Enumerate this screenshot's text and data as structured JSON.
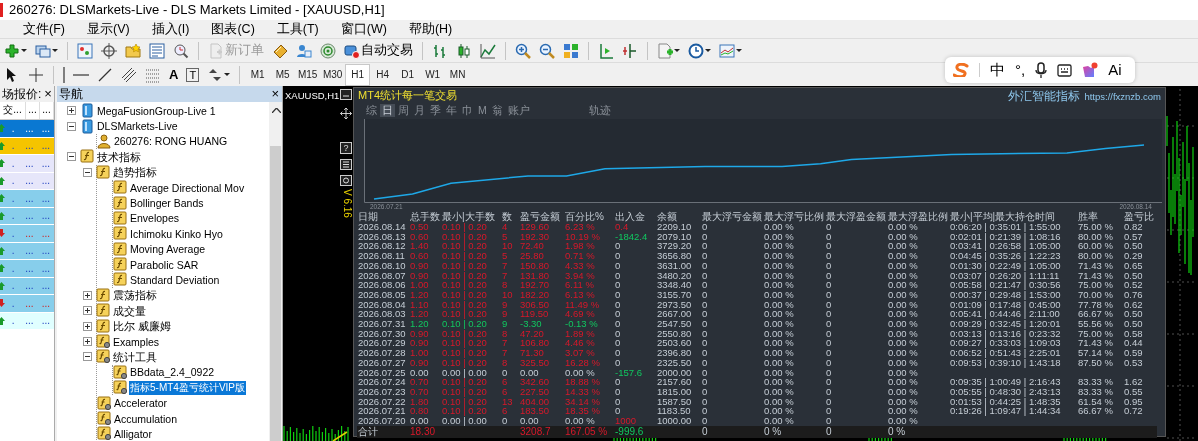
{
  "window": {
    "title": "260276: DLSMarkets-Live - DLS Markets Limited - [XAUUSD,H1]"
  },
  "menu": [
    "文件(F)",
    "显示(V)",
    "插入(I)",
    "图表(C)",
    "工具(T)",
    "窗口(W)",
    "帮助(H)"
  ],
  "toolbar": {
    "buttons": [
      {
        "label": "新订单",
        "disabled": true
      },
      {
        "label": "自动交易",
        "disabled": false
      }
    ]
  },
  "drawing_tools": [
    "A",
    "T"
  ],
  "timeframes": [
    {
      "label": "M1",
      "selected": false
    },
    {
      "label": "M5",
      "selected": false
    },
    {
      "label": "M15",
      "selected": false
    },
    {
      "label": "M30",
      "selected": false
    },
    {
      "label": "H1",
      "selected": true
    },
    {
      "label": "H4",
      "selected": false
    },
    {
      "label": "D1",
      "selected": false
    },
    {
      "label": "W1",
      "selected": false
    },
    {
      "label": "MN",
      "selected": false
    }
  ],
  "ime_bar": {
    "mode": "中",
    "punctuation": "°,",
    "ai": "Ai"
  },
  "market_watch": {
    "title": "场报价:",
    "close": "×",
    "columns": [
      "交...",
      "...",
      "..."
    ],
    "rows": [
      {
        "color": "#0a78d2",
        "rising": true,
        "selected": true,
        "cells": [
          ".",
          "...",
          "..."
        ]
      },
      {
        "color": "#f5c400",
        "rising": true,
        "selected": false,
        "cells": [
          ".",
          "...",
          "..."
        ]
      },
      {
        "color": "#e6e6fa",
        "rising": true,
        "selected": false,
        "cells": [
          ".",
          "...",
          "..."
        ]
      },
      {
        "color": "#e6e6fa",
        "rising": true,
        "selected": false,
        "cells": [
          ".",
          "...",
          "..."
        ]
      },
      {
        "color": "#87ceeb",
        "rising": true,
        "selected": false,
        "cells": [
          ".",
          "...",
          "..."
        ]
      },
      {
        "color": "#87ceeb",
        "rising": true,
        "selected": false,
        "cells": [
          ".",
          "...",
          "..."
        ]
      },
      {
        "color": "#87ceeb",
        "rising": false,
        "selected": false,
        "cells": [
          ".",
          "...",
          "..."
        ]
      },
      {
        "color": "#87ceeb",
        "rising": true,
        "selected": false,
        "cells": [
          ".",
          "...",
          "..."
        ]
      },
      {
        "color": "#87ceeb",
        "rising": true,
        "selected": false,
        "cells": [
          ".",
          "...",
          "..."
        ]
      },
      {
        "color": "#87ceeb",
        "rising": true,
        "selected": false,
        "cells": [
          ".",
          "...",
          "..."
        ]
      },
      {
        "color": "#87ceeb",
        "rising": false,
        "selected": false,
        "cells": [
          ".",
          "...",
          "..."
        ]
      },
      {
        "color": "#e0ffff",
        "rising": true,
        "selected": false,
        "cells": [
          ".",
          "...",
          "..."
        ]
      }
    ]
  },
  "navigator": {
    "title": "导航",
    "close": "×",
    "tree": [
      {
        "label": "MegaFusionGroup-Live 1",
        "kind": "server",
        "expanded": false,
        "selected": false
      },
      {
        "label": "DLSMarkets-Live",
        "kind": "server",
        "expanded": true,
        "selected": false,
        "children": [
          {
            "label": "260276: RONG HUANG",
            "kind": "account",
            "selected": false
          }
        ]
      },
      {
        "label": "技术指标",
        "kind": "indicator",
        "expanded": true,
        "selected": false,
        "children": [
          {
            "label": "趋势指标",
            "kind": "indicator",
            "expanded": true,
            "selected": false,
            "children": [
              {
                "label": "Average Directional Mov",
                "kind": "indicator",
                "selected": false
              },
              {
                "label": "Bollinger Bands",
                "kind": "indicator",
                "selected": false
              },
              {
                "label": "Envelopes",
                "kind": "indicator",
                "selected": false
              },
              {
                "label": "Ichimoku Kinko Hyo",
                "kind": "indicator",
                "selected": false
              },
              {
                "label": "Moving Average",
                "kind": "indicator",
                "selected": false
              },
              {
                "label": "Parabolic SAR",
                "kind": "indicator",
                "selected": false
              },
              {
                "label": "Standard Deviation",
                "kind": "indicator",
                "selected": false
              }
            ]
          },
          {
            "label": "震荡指标",
            "kind": "indicator",
            "expanded": false,
            "selected": false
          },
          {
            "label": "成交量",
            "kind": "indicator",
            "expanded": false,
            "selected": false
          },
          {
            "label": "比尔 威廉姆",
            "kind": "indicator",
            "expanded": false,
            "selected": false
          },
          {
            "label": "Examples",
            "kind": "custom",
            "expanded": false,
            "selected": false
          },
          {
            "label": "统计工具",
            "kind": "custom",
            "expanded": true,
            "selected": false,
            "children": [
              {
                "label": "BBdata_2.4_0922",
                "kind": "custom",
                "selected": false
              },
              {
                "label": "指标5-MT4盈亏统计VIP版",
                "kind": "custom",
                "selected": true
              }
            ]
          },
          {
            "label": "Accelerator",
            "kind": "custom",
            "selected": false
          },
          {
            "label": "Accumulation",
            "kind": "custom",
            "selected": false
          },
          {
            "label": "Alligator",
            "kind": "custom",
            "selected": false
          }
        ]
      }
    ]
  },
  "chart": {
    "symbol": "XAUUSD,H1",
    "help": "?",
    "version": "V 6.16"
  },
  "stats_panel": {
    "title": "MT4统计每一笔交易",
    "brand": "外汇智能指标",
    "url": "https://fxznzb.com",
    "tabs": [
      {
        "label": "综",
        "selected": false
      },
      {
        "label": "日",
        "selected": true
      },
      {
        "label": "周",
        "selected": false
      },
      {
        "label": "月",
        "selected": false
      },
      {
        "label": "季",
        "selected": false
      },
      {
        "label": "年",
        "selected": false
      },
      {
        "label": "巾",
        "selected": false
      },
      {
        "label": "M",
        "selected": false
      },
      {
        "label": "翁",
        "selected": false
      },
      {
        "label": "账户",
        "selected": false
      }
    ],
    "trace_tab": {
      "label": "轨迹",
      "selected": false
    },
    "equity_chart": {
      "start_label": "2026.07.21",
      "end_label": "2026.08.14"
    },
    "columns": [
      "日期",
      "总手数",
      "最小|大手数",
      "数",
      "盈亏金额",
      "百分比%",
      "出入金",
      "余额",
      "最大浮亏金额",
      "最大浮亏比例",
      "最大浮盈金额",
      "最大浮盈比例",
      "最小|平均|最大持仓时间",
      "胜率",
      "盈亏比"
    ],
    "rows": [
      {
        "gain": true,
        "loss": false,
        "deposit": true,
        "withdrawal": false,
        "cells": [
          "2026.08.14",
          "0.50",
          "0.10 | 0.20",
          "4",
          "129.60",
          "6.23 %",
          "0.4",
          "2209.10",
          "0",
          "0.00 %",
          "0",
          "0.00 %",
          "0:06:20 | 0:35:01 | 1:55:00",
          "75.00 %",
          "0.82"
        ]
      },
      {
        "gain": true,
        "loss": false,
        "deposit": false,
        "withdrawal": true,
        "cells": [
          "2026.08.13",
          "0.60",
          "0.10 | 0.20",
          "5",
          "192.30",
          "10.19 %",
          "-1842.4",
          "2079.10",
          "0",
          "0.00 %",
          "0",
          "0.00 %",
          "0:02:01 | 0:21:39 | 1:08:16",
          "80.00 %",
          "0.57"
        ]
      },
      {
        "gain": true,
        "loss": false,
        "deposit": false,
        "withdrawal": false,
        "cells": [
          "2026.08.12",
          "1.40",
          "0.10 | 0.20",
          "10",
          "72.40",
          "1.98 %",
          "0",
          "3729.20",
          "0",
          "0.00 %",
          "0",
          "0.00 %",
          "0:03:41 | 0:26:58 | 1:05:00",
          "60.00 %",
          "0.50"
        ]
      },
      {
        "gain": true,
        "loss": false,
        "deposit": false,
        "withdrawal": false,
        "cells": [
          "2026.08.11",
          "0.60",
          "0.10 | 0.20",
          "5",
          "25.80",
          "0.71 %",
          "0",
          "3656.80",
          "0",
          "0.00 %",
          "0",
          "0.00 %",
          "0:04:45 | 0:35:26 | 1:22:23",
          "80.00 %",
          "0.29"
        ]
      },
      {
        "gain": true,
        "loss": false,
        "deposit": false,
        "withdrawal": false,
        "cells": [
          "2026.08.10",
          "0.90",
          "0.10 | 0.20",
          "7",
          "150.80",
          "4.33 %",
          "0",
          "3631.00",
          "0",
          "0.00 %",
          "0",
          "0.00 %",
          "0:01:30 | 0:22:49 | 1:05:00",
          "71.43 %",
          "0.65"
        ]
      },
      {
        "gain": true,
        "loss": false,
        "deposit": false,
        "withdrawal": false,
        "cells": [
          "2026.08.07",
          "0.90",
          "0.10 | 0.20",
          "7",
          "131.80",
          "3.94 %",
          "0",
          "3480.20",
          "0",
          "0.00 %",
          "0",
          "0.00 %",
          "0:03:07 | 0:26:20 | 1:11:11",
          "71.43 %",
          "0.50"
        ]
      },
      {
        "gain": true,
        "loss": false,
        "deposit": false,
        "withdrawal": false,
        "cells": [
          "2026.08.06",
          "1.00",
          "0.10 | 0.20",
          "8",
          "192.70",
          "6.11 %",
          "0",
          "3348.40",
          "0",
          "0.00 %",
          "0",
          "0.00 %",
          "0:05:58 | 0:21:47 | 0:30:56",
          "75.00 %",
          "0.52"
        ]
      },
      {
        "gain": true,
        "loss": false,
        "deposit": false,
        "withdrawal": false,
        "cells": [
          "2026.08.05",
          "1.20",
          "0.10 | 0.20",
          "10",
          "182.20",
          "6.13 %",
          "0",
          "3155.70",
          "0",
          "0.00 %",
          "0",
          "0.00 %",
          "0:00:37 | 0:29:48 | 1:53:00",
          "70.00 %",
          "0.76"
        ]
      },
      {
        "gain": true,
        "loss": false,
        "deposit": false,
        "withdrawal": false,
        "cells": [
          "2026.08.04",
          "1.10",
          "0.10 | 0.20",
          "9",
          "306.50",
          "11.49 %",
          "0",
          "2973.50",
          "0",
          "0.00 %",
          "0",
          "0.00 %",
          "0:01:09 | 0:17:48 | 0:45:00",
          "77.78 %",
          "0.62"
        ]
      },
      {
        "gain": true,
        "loss": false,
        "deposit": false,
        "withdrawal": false,
        "cells": [
          "2026.08.03",
          "1.20",
          "0.10 | 0.20",
          "9",
          "119.50",
          "4.69 %",
          "0",
          "2667.00",
          "0",
          "0.00 %",
          "0",
          "0.00 %",
          "0:05:41 | 0:44:46 | 2:11:00",
          "66.67 %",
          "0.50"
        ]
      },
      {
        "gain": false,
        "loss": true,
        "deposit": false,
        "withdrawal": false,
        "cells": [
          "2026.07.31",
          "1.20",
          "0.10 | 0.20",
          "9",
          "-3.30",
          "-0.13 %",
          "0",
          "2547.50",
          "0",
          "0.00 %",
          "0",
          "0.00 %",
          "0:09:29 | 0:32:45 | 1:20:01",
          "55.56 %",
          "0.50"
        ]
      },
      {
        "gain": true,
        "loss": false,
        "deposit": false,
        "withdrawal": false,
        "cells": [
          "2026.07.30",
          "0.90",
          "0.10 | 0.20",
          "8",
          "47.20",
          "1.89 %",
          "0",
          "2550.80",
          "0",
          "0.00 %",
          "0",
          "0.00 %",
          "0:03:13 | 0:13:16 | 0:23:32",
          "75.00 %",
          "0.58"
        ]
      },
      {
        "gain": true,
        "loss": false,
        "deposit": false,
        "withdrawal": false,
        "cells": [
          "2026.07.29",
          "0.90",
          "0.10 | 0.20",
          "7",
          "106.80",
          "4.46 %",
          "0",
          "2503.60",
          "0",
          "0.00 %",
          "0",
          "0.00 %",
          "0:09:27 | 0:33:03 | 1:09:03",
          "71.43 %",
          "0.44"
        ]
      },
      {
        "gain": true,
        "loss": false,
        "deposit": false,
        "withdrawal": false,
        "cells": [
          "2026.07.28",
          "1.00",
          "0.10 | 0.20",
          "7",
          "71.30",
          "3.07 %",
          "0",
          "2396.80",
          "0",
          "0.00 %",
          "0",
          "0.00 %",
          "0:06:52 | 0:51:43 | 2:25:01",
          "57.14 %",
          "0.59"
        ]
      },
      {
        "gain": true,
        "loss": false,
        "deposit": false,
        "withdrawal": false,
        "cells": [
          "2026.07.27",
          "0.90",
          "0.10 | 0.20",
          "8",
          "325.50",
          "16.28 %",
          "0",
          "2325.50",
          "0",
          "0.00 %",
          "0",
          "0.00 %",
          "0:09:53 | 0:39:10 | 1:43:18",
          "87.50 %",
          "0.53"
        ]
      },
      {
        "gain": false,
        "loss": false,
        "deposit": false,
        "withdrawal": true,
        "cells": [
          "2026.07.25",
          "0.00",
          "0.00 | 0.00",
          "0",
          "0.00",
          "0.00 %",
          "-157.6",
          "2000.00",
          "0",
          "0.00 %",
          "0",
          "0.00 %",
          null,
          null,
          null
        ]
      },
      {
        "gain": true,
        "loss": false,
        "deposit": false,
        "withdrawal": false,
        "cells": [
          "2026.07.24",
          "0.70",
          "0.10 | 0.20",
          "6",
          "342.60",
          "18.88 %",
          "0",
          "2157.60",
          "0",
          "0.00 %",
          "0",
          "0.00 %",
          "0:09:35 | 1:00:49 | 2:16:43",
          "83.33 %",
          "1.62"
        ]
      },
      {
        "gain": true,
        "loss": false,
        "deposit": false,
        "withdrawal": false,
        "cells": [
          "2026.07.23",
          "0.70",
          "0.10 | 0.20",
          "6",
          "227.50",
          "14.33 %",
          "0",
          "1815.00",
          "0",
          "0.00 %",
          "0",
          "0.00 %",
          "0:05:55 | 0:48:30 | 2:43:13",
          "83.33 %",
          "0.55"
        ]
      },
      {
        "gain": true,
        "loss": false,
        "deposit": false,
        "withdrawal": false,
        "cells": [
          "2026.07.22",
          "1.80",
          "0.10 | 0.20",
          "13",
          "404.00",
          "34.14 %",
          "0",
          "1587.50",
          "0",
          "0.00 %",
          "0",
          "0.00 %",
          "0:01:53 | 0:44:25 | 1:48:35",
          "61.54 %",
          "0.95"
        ]
      },
      {
        "gain": true,
        "loss": false,
        "deposit": false,
        "withdrawal": false,
        "cells": [
          "2026.07.21",
          "0.80",
          "0.10 | 0.20",
          "6",
          "183.50",
          "18.35 %",
          "0",
          "1183.50",
          "0",
          "0.00 %",
          "0",
          "0.00 %",
          "0:19:26 | 1:09:47 | 1:44:34",
          "66.67 %",
          "0.72"
        ]
      },
      {
        "gain": false,
        "loss": false,
        "deposit": true,
        "withdrawal": false,
        "cells": [
          "2026.07.20",
          "0.00",
          "0.00 | 0.00",
          "0",
          "0.00",
          "0.00 %",
          "1000",
          "1000.00",
          "0",
          "0.00 %",
          "0",
          "0.00 %",
          null,
          null,
          null
        ]
      }
    ],
    "total": {
      "gain": true,
      "loss": false,
      "deposit": false,
      "withdrawal": true,
      "cells": [
        "合计",
        "18.30",
        null,
        null,
        "3208.7",
        "167.05 %",
        "-999.6",
        null,
        "0",
        "0 %",
        "0",
        "0 %",
        null,
        null,
        null
      ]
    }
  }
}
